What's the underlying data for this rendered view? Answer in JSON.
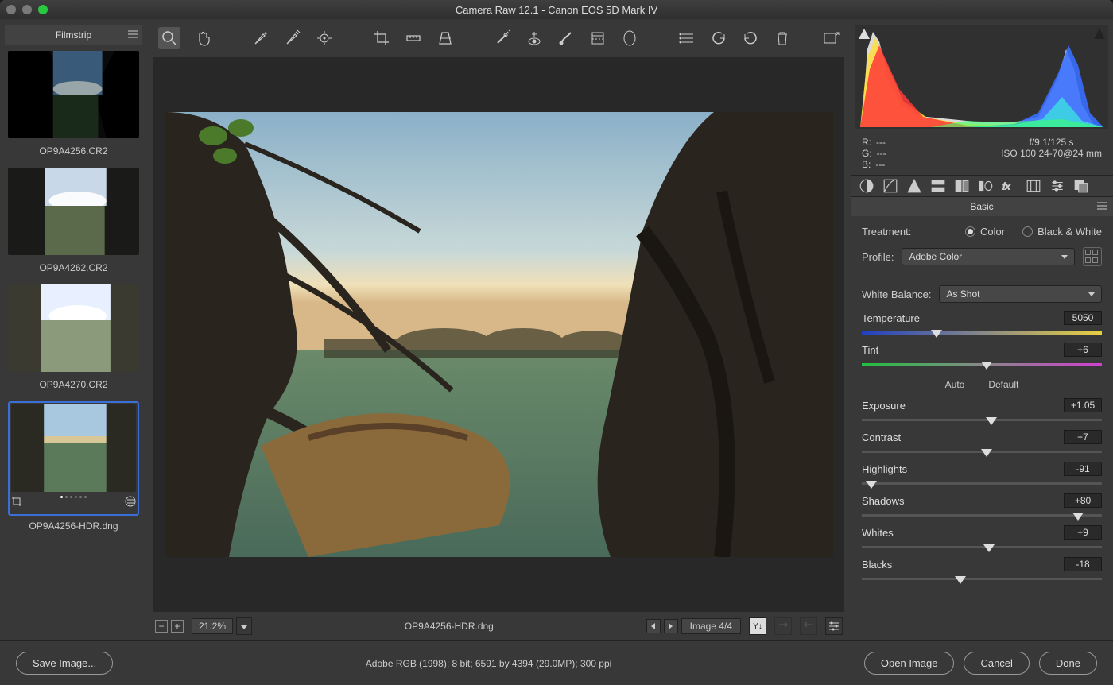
{
  "titlebar": {
    "title": "Camera Raw 12.1  -  Canon EOS 5D Mark IV"
  },
  "filmstrip": {
    "header": "Filmstrip",
    "items": [
      {
        "caption": "OP9A4256.CR2",
        "selected": false
      },
      {
        "caption": "OP9A4262.CR2",
        "selected": false
      },
      {
        "caption": "OP9A4270.CR2",
        "selected": false
      },
      {
        "caption": "OP9A4256-HDR.dng",
        "selected": true
      }
    ]
  },
  "statusbar": {
    "zoom": "21.2%",
    "filename": "OP9A4256-HDR.dng",
    "image_counter": "Image 4/4"
  },
  "info": {
    "r": "R:",
    "r_val": "---",
    "g": "G:",
    "g_val": "---",
    "b": "B:",
    "b_val": "---",
    "exif1": "f/9   1/125 s",
    "exif2": "ISO 100   24-70@24 mm"
  },
  "panel": {
    "title": "Basic",
    "treatment_label": "Treatment:",
    "treatment_color": "Color",
    "treatment_bw": "Black & White",
    "profile_label": "Profile:",
    "profile_value": "Adobe Color",
    "wb_label": "White Balance:",
    "wb_value": "As Shot",
    "auto": "Auto",
    "default": "Default",
    "sliders": {
      "temperature": {
        "label": "Temperature",
        "value": "5050",
        "pos": 31
      },
      "tint": {
        "label": "Tint",
        "value": "+6",
        "pos": 52
      },
      "exposure": {
        "label": "Exposure",
        "value": "+1.05",
        "pos": 54
      },
      "contrast": {
        "label": "Contrast",
        "value": "+7",
        "pos": 52
      },
      "highlights": {
        "label": "Highlights",
        "value": "-91",
        "pos": 4
      },
      "shadows": {
        "label": "Shadows",
        "value": "+80",
        "pos": 90
      },
      "whites": {
        "label": "Whites",
        "value": "+9",
        "pos": 53
      },
      "blacks": {
        "label": "Blacks",
        "value": "-18",
        "pos": 41
      }
    }
  },
  "footer": {
    "save": "Save Image...",
    "link": "Adobe RGB (1998); 8 bit; 6591 by 4394 (29.0MP); 300 ppi",
    "open": "Open Image",
    "cancel": "Cancel",
    "done": "Done"
  }
}
